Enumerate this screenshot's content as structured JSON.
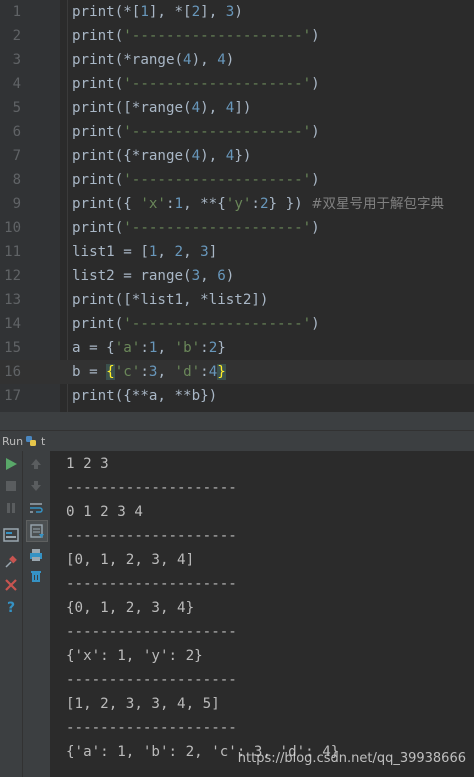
{
  "editor": {
    "line_numbers": [
      "1",
      "2",
      "3",
      "4",
      "5",
      "6",
      "7",
      "8",
      "9",
      "10",
      "11",
      "12",
      "13",
      "14",
      "15",
      "16",
      "17"
    ],
    "lines": {
      "l1": {
        "a": "print(*[",
        "n1": "1",
        "b": "], *[",
        "n2": "2",
        "c": "], ",
        "n3": "3",
        "d": ")"
      },
      "l2": {
        "a": "print(",
        "s": "'--------------------'",
        "b": ")"
      },
      "l3": {
        "a": "print(*range(",
        "n1": "4",
        "b": "), ",
        "n2": "4",
        "c": ")"
      },
      "l4": {
        "a": "print(",
        "s": "'--------------------'",
        "b": ")"
      },
      "l5": {
        "a": "print([*range(",
        "n1": "4",
        "b": "), ",
        "n2": "4",
        "c": "])"
      },
      "l6": {
        "a": "print(",
        "s": "'--------------------'",
        "b": ")"
      },
      "l7": {
        "a": "print({*range(",
        "n1": "4",
        "b": "), ",
        "n2": "4",
        "c": "})"
      },
      "l8": {
        "a": "print(",
        "s": "'--------------------'",
        "b": ")"
      },
      "l9": {
        "a": "print({ ",
        "s1": "'x'",
        "b": ":",
        "n1": "1",
        "c": ", **{",
        "s2": "'y'",
        "d": ":",
        "n2": "2",
        "e": "} }) ",
        "cm": "#双星号用于解包字典"
      },
      "l10": {
        "a": "print(",
        "s": "'--------------------'",
        "b": ")"
      },
      "l11": {
        "a": "list1 = [",
        "n1": "1",
        "b": ", ",
        "n2": "2",
        "c": ", ",
        "n3": "3",
        "d": "]"
      },
      "l12": {
        "a": "list2 = range(",
        "n1": "3",
        "b": ", ",
        "n2": "6",
        "c": ")"
      },
      "l13": {
        "a": "print([*list1, *list2])"
      },
      "l14": {
        "a": "print(",
        "s": "'--------------------'",
        "b": ")"
      },
      "l15": {
        "a": "a = {",
        "s1": "'a'",
        "b": ":",
        "n1": "1",
        "c": ", ",
        "s2": "'b'",
        "d": ":",
        "n2": "2",
        "e": "}"
      },
      "l16": {
        "a": "b = ",
        "br1": "{",
        "s1": "'c'",
        "b": ":",
        "n1": "3",
        "c": ", ",
        "s2": "'d'",
        "d": ":",
        "n2": "4",
        "br2": "}"
      },
      "l17": {
        "a": "print({**a, **b})"
      }
    }
  },
  "run_panel": {
    "label": "Run",
    "target": "t",
    "toolbar_icons": [
      "run-icon",
      "stop-icon",
      "pause-icon",
      "layout-icon",
      "pin-icon",
      "close-icon",
      "help-icon",
      "scroll-up-icon",
      "scroll-down-icon",
      "soft-wrap-icon",
      "scroll-to-end-icon",
      "print-icon",
      "trash-icon"
    ]
  },
  "console": {
    "lines": [
      "1 2 3",
      "--------------------",
      "0 1 2 3 4",
      "--------------------",
      "[0, 1, 2, 3, 4]",
      "--------------------",
      "{0, 1, 2, 3, 4}",
      "--------------------",
      "{'x': 1, 'y': 2}",
      "--------------------",
      "[1, 2, 3, 3, 4, 5]",
      "--------------------",
      "{'a': 1, 'b': 2, 'c': 3, 'd': 4}"
    ]
  },
  "watermark": "https://blog.csdn.net/qq_39938666",
  "colors": {
    "editor_bg": "#2b2b2b",
    "gutter_bg": "#313335",
    "keyword_text": "#a9b7c6",
    "number": "#6897bb",
    "string": "#6a8759",
    "comment": "#808080",
    "brace_match": "#ffef28",
    "run_green": "#59a869"
  }
}
